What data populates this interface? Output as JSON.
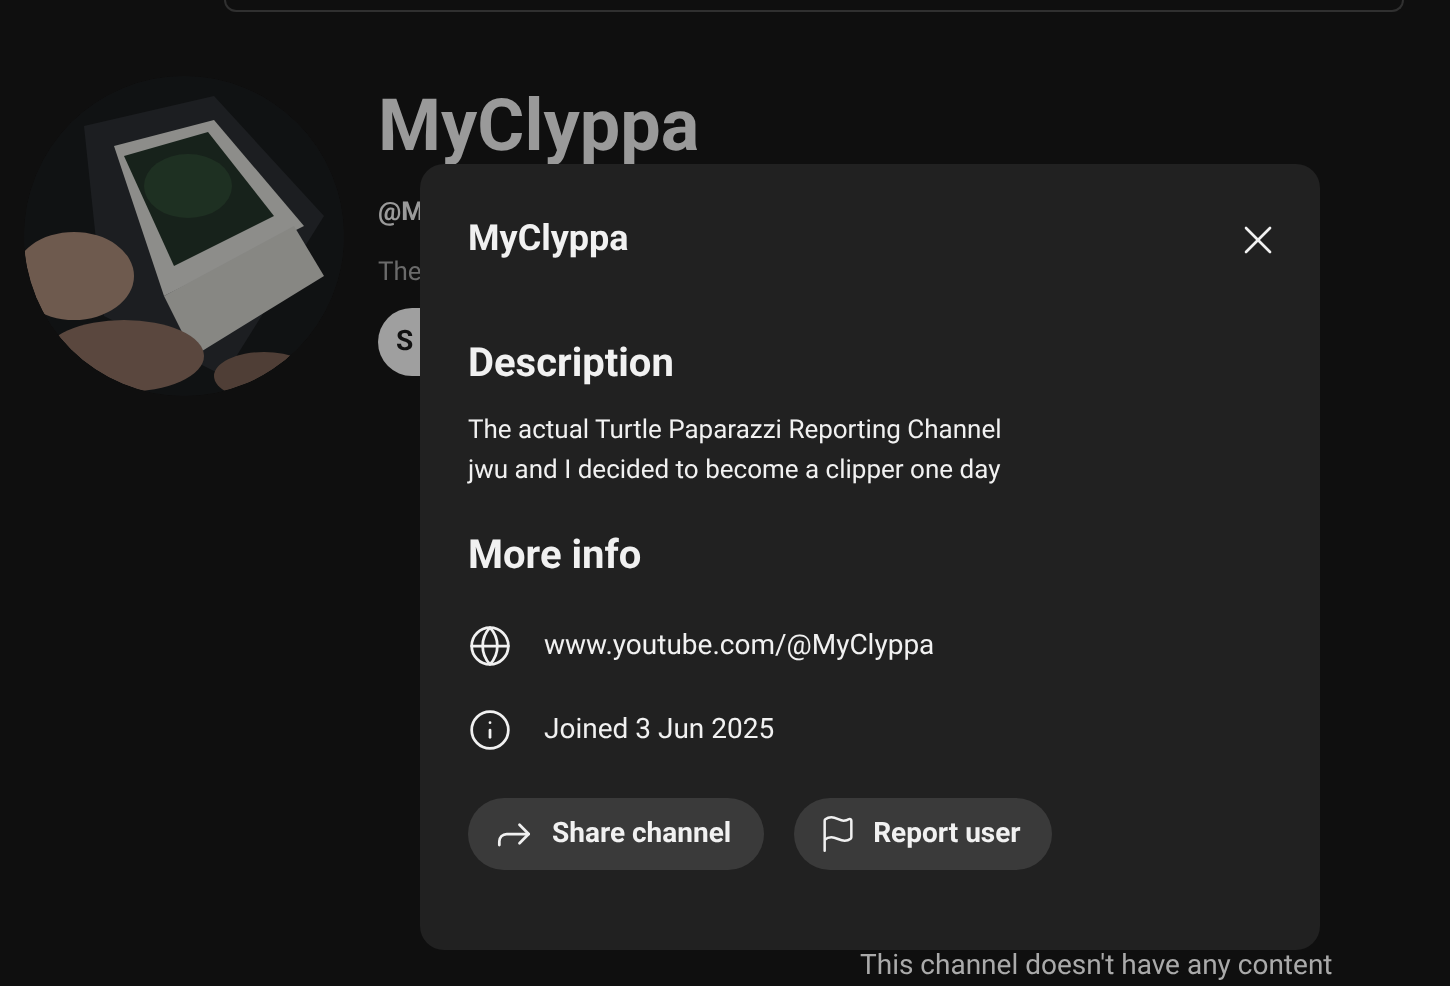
{
  "channel": {
    "name": "MyClyppa",
    "handle": "@M",
    "description": "The",
    "button": "S",
    "empty_message": "This channel doesn't have any content"
  },
  "dialog": {
    "title": "MyClyppa",
    "description_heading": "Description",
    "description_lines": [
      "The actual Turtle Paparazzi Reporting Channel",
      "jwu and I decided to become a clipper one day"
    ],
    "more_info_heading": "More info",
    "info_rows": [
      {
        "kind": "link",
        "text": "www.youtube.com/@MyClyppa"
      },
      {
        "kind": "joined",
        "text": "Joined 3 Jun 2025"
      }
    ],
    "actions": [
      {
        "kind": "share",
        "label": "Share channel"
      },
      {
        "kind": "report",
        "label": "Report user"
      }
    ]
  }
}
